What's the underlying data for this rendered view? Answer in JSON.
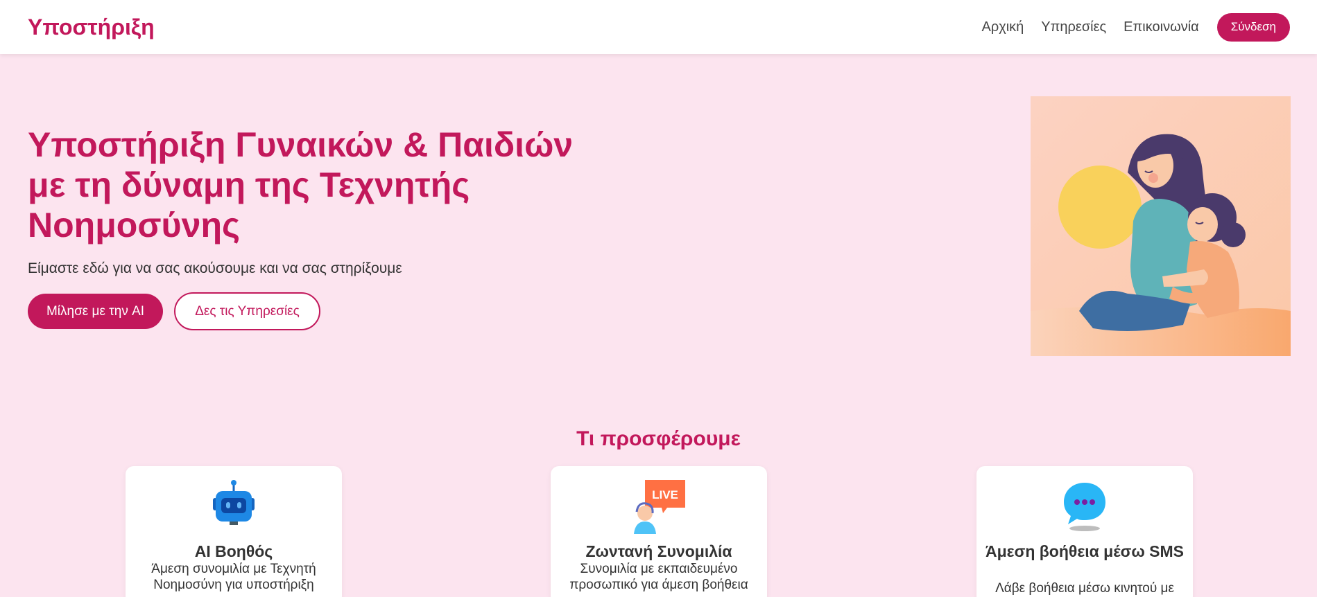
{
  "header": {
    "brand": "Υποστήριξη",
    "nav": [
      "Αρχική",
      "Υπηρεσίες",
      "Επικοινωνία"
    ],
    "login_label": "Σύνδεση"
  },
  "hero": {
    "title": "Υποστήριξη Γυναικών & Παιδιών με τη δύναμη της Τεχνητής Νοημοσύνης",
    "subtitle": "Είμαστε εδώ για να σας ακούσουμε και να σας στηρίξουμε",
    "primary_button": "Μίλησε με την AI",
    "secondary_button": "Δες τις Υπηρεσίες"
  },
  "services": {
    "title": "Τι προσφέρουμε",
    "cards": [
      {
        "icon": "robot-icon",
        "title": "AI Βοηθός",
        "description": "Άμεση συνομιλία με Τεχνητή Νοημοσύνη για υποστήριξη"
      },
      {
        "icon": "live-chat-icon",
        "icon_badge": "LIVE",
        "title": "Ζωντανή Συνομιλία",
        "description": "Συνομιλία με εκπαιδευμένο προσωπικό για άμεση βοήθεια"
      },
      {
        "icon": "sms-bubble-icon",
        "title": "Άμεση βοήθεια μέσω SMS",
        "description": "Λάβε βοήθεια μέσω κινητού με"
      }
    ]
  },
  "colors": {
    "accent": "#c2185b",
    "background": "#fce4ef",
    "illustration_bg": "#fbd0bc"
  }
}
